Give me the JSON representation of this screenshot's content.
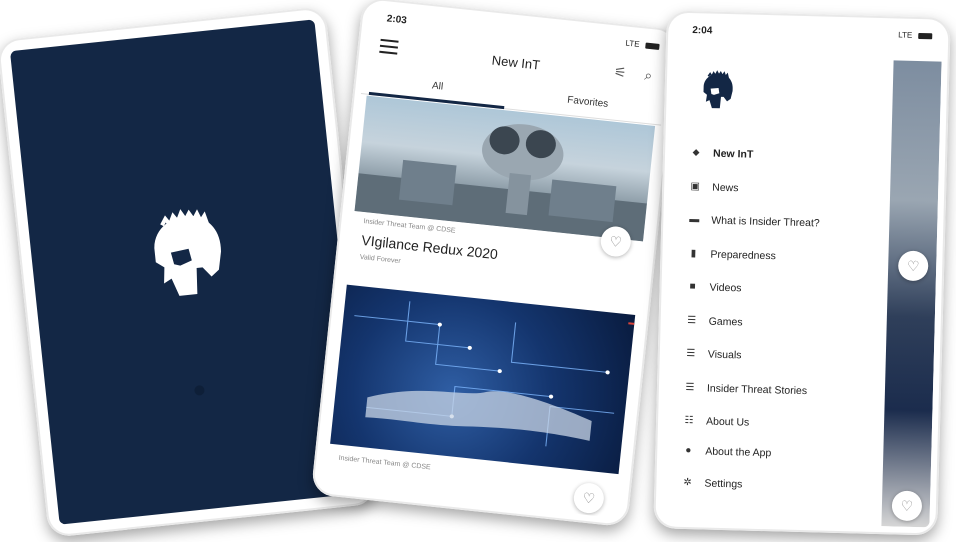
{
  "phone_splash": {
    "logo_icon": "spartan-helmet-icon"
  },
  "phone_feed": {
    "status": {
      "time": "2:03",
      "network": "LTE"
    },
    "app_title": "New InT",
    "tabs": [
      {
        "label": "All"
      },
      {
        "label": "Favorites"
      }
    ],
    "cards": [
      {
        "meta": "Insider Threat Team @ CDSE",
        "title": "VIgilance Redux 2020",
        "sub": "Valid Forever"
      },
      {
        "meta": "Insider Threat Team @ CDSE",
        "title": "",
        "sub": ""
      }
    ]
  },
  "phone_drawer": {
    "status": {
      "time": "2:04",
      "network": "LTE"
    },
    "menu_items": [
      {
        "label": "New InT",
        "icon": "tag-icon"
      },
      {
        "label": "News",
        "icon": "image-icon"
      },
      {
        "label": "What is Insider Threat?",
        "icon": "card-icon"
      },
      {
        "label": "Preparedness",
        "icon": "bar-icon"
      },
      {
        "label": "Videos",
        "icon": "video-icon"
      },
      {
        "label": "Games",
        "icon": "list-icon"
      },
      {
        "label": "Visuals",
        "icon": "list-icon"
      },
      {
        "label": "Insider Threat Stories",
        "icon": "list-icon"
      },
      {
        "label": "About Us",
        "icon": "list-bars-icon"
      }
    ],
    "bottom_items": [
      {
        "label": "About the App",
        "icon": "info-icon"
      },
      {
        "label": "Settings",
        "icon": "gear-icon"
      }
    ]
  }
}
